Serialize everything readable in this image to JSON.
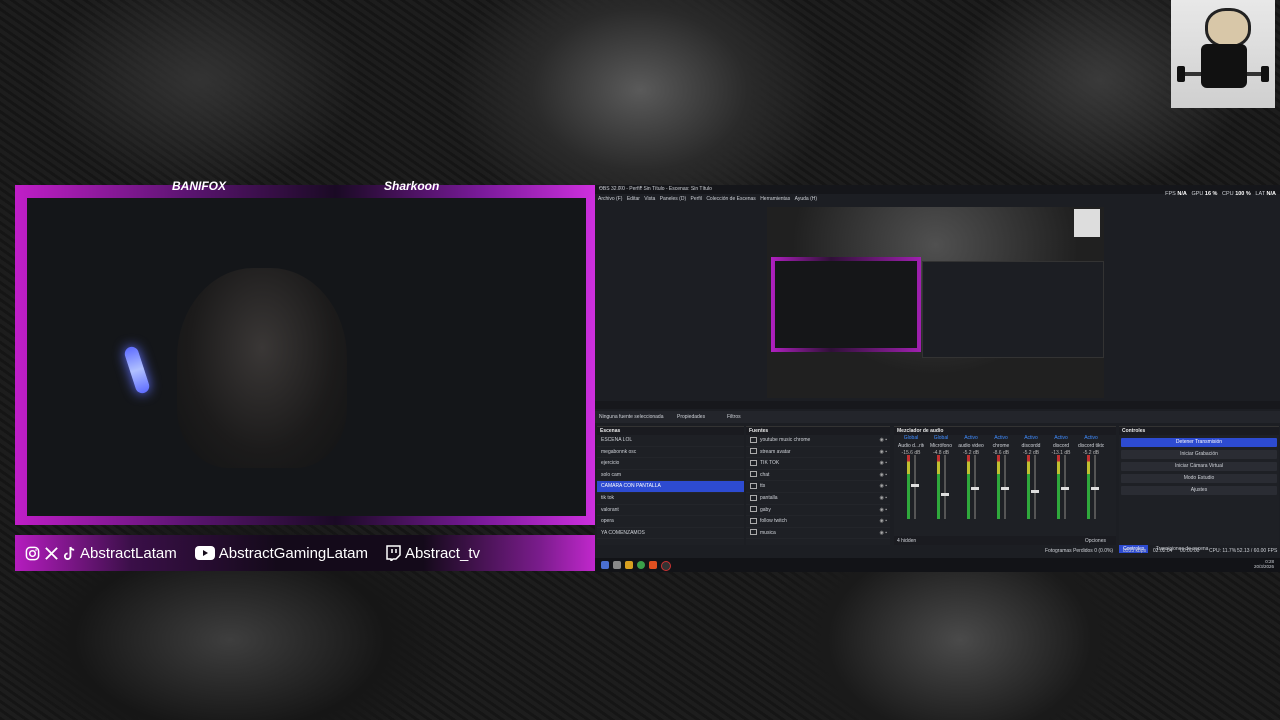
{
  "sponsors": {
    "left": "BANIFOX",
    "right": "Sharkoon"
  },
  "social": {
    "handle_1": "AbstractLatam",
    "handle_2": "AbstractGamingLatam",
    "handle_3": "Abstract_tv"
  },
  "obs": {
    "title": "OBS 32.0.0 - Perfil: Sin Título - Escenas: Sin Título",
    "menu": [
      "Archivo (F)",
      "Editar",
      "Vista",
      "Paneles (D)",
      "Perfil",
      "Colección de Escenas",
      "Herramientas",
      "Ayuda (H)"
    ],
    "stats": {
      "fps_label": "FPS",
      "fps_value": "N/A",
      "gpu_label": "GPU",
      "gpu_value": "16 %",
      "cpu_label": "CPU",
      "cpu_value": "100 %",
      "lat_label": "LAT",
      "lat_value": "N/A"
    },
    "toolbar": {
      "no_source": "Ninguna fuente seleccionada",
      "properties": "Propiedades",
      "filters": "Filtros"
    },
    "scenes": {
      "header": "Escenas",
      "items": [
        "ESCENA LOL",
        "megabonnk osc",
        "ejercicio",
        "solo cam",
        "CAMARA CON PANTALLA",
        "tik tok",
        "valorant",
        "opera",
        "YA COMENZAMOS"
      ],
      "selected_index": 4
    },
    "sources": {
      "header": "Fuentes",
      "items": [
        "youtube music chrome",
        "stream avatar",
        "TIK TOK",
        "chat",
        "tts",
        "pantalla",
        "gaby",
        "follow twitch",
        "musica"
      ]
    },
    "mixer": {
      "header": "Mezclador de audio",
      "channels": [
        {
          "tag": "Global",
          "name": "Audio d...ritorio",
          "db": "-15.6 dB",
          "level": 0.55
        },
        {
          "tag": "Global",
          "name": "Micrófono",
          "db": "-4.8 dB",
          "level": 0.4
        },
        {
          "tag": "Activo",
          "name": "audio video",
          "db": "-5.2 dB",
          "level": 0.5
        },
        {
          "tag": "Activo",
          "name": "chrome",
          "db": "-8.6 dB",
          "level": 0.5
        },
        {
          "tag": "Activo",
          "name": "discordd",
          "db": "-5.2 dB",
          "level": 0.45
        },
        {
          "tag": "Activo",
          "name": "discord",
          "db": "-13.1 dB",
          "level": 0.5
        },
        {
          "tag": "Activo",
          "name": "discord tiktok",
          "db": "-5.2 dB",
          "level": 0.5
        }
      ],
      "hidden": "4 hidden",
      "options": "Opciones"
    },
    "controls": {
      "header": "Controles",
      "buttons": [
        "Detener Transmisión",
        "Iniciar Grabación",
        "Iniciar Cámara Virtual",
        "Modo Estudio",
        "Ajustes"
      ]
    },
    "tabs": [
      "Controles",
      "Transiciones de escena"
    ],
    "status": {
      "dropped": "Fotogramas Perdidos 0 (0.0%)",
      "bitrate": "8533 kbps",
      "live_time": "02:02:04",
      "rec_time": "00:00:00",
      "cpu": "CPU: 11.7%",
      "fps": "52.13 / 60.00 FPS"
    },
    "taskbar": {
      "time": "0:28",
      "date": "20/3/2026"
    }
  },
  "colors": {
    "accent": "#2d4bd1",
    "frame": "#c01ec8"
  }
}
